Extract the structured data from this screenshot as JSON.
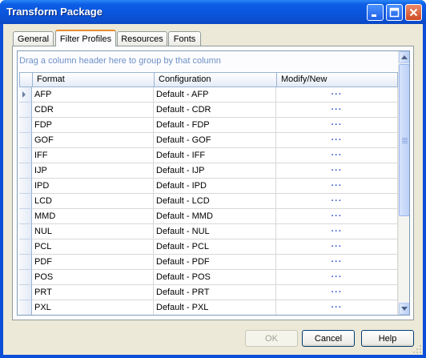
{
  "window": {
    "title": "Transform Package",
    "controls": {
      "minimize": "minimize-icon",
      "maximize": "maximize-icon",
      "close": "close-icon"
    }
  },
  "tabs": [
    {
      "label": "General",
      "active": false
    },
    {
      "label": "Filter Profiles",
      "active": true
    },
    {
      "label": "Resources",
      "active": false
    },
    {
      "label": "Fonts",
      "active": false
    }
  ],
  "grid": {
    "group_hint": "Drag a column header here to group by that column",
    "columns": [
      "Format",
      "Configuration",
      "Modify/New"
    ],
    "rows": [
      {
        "format": "AFP",
        "configuration": "Default - AFP",
        "action": "···"
      },
      {
        "format": "CDR",
        "configuration": "Default - CDR",
        "action": "···"
      },
      {
        "format": "FDP",
        "configuration": "Default - FDP",
        "action": "···"
      },
      {
        "format": "GOF",
        "configuration": "Default - GOF",
        "action": "···"
      },
      {
        "format": "IFF",
        "configuration": "Default - IFF",
        "action": "···"
      },
      {
        "format": "IJP",
        "configuration": "Default - IJP",
        "action": "···"
      },
      {
        "format": "IPD",
        "configuration": "Default - IPD",
        "action": "···"
      },
      {
        "format": "LCD",
        "configuration": "Default - LCD",
        "action": "···"
      },
      {
        "format": "MMD",
        "configuration": "Default - MMD",
        "action": "···"
      },
      {
        "format": "NUL",
        "configuration": "Default - NUL",
        "action": "···"
      },
      {
        "format": "PCL",
        "configuration": "Default - PCL",
        "action": "···"
      },
      {
        "format": "PDF",
        "configuration": "Default - PDF",
        "action": "···"
      },
      {
        "format": "POS",
        "configuration": "Default - POS",
        "action": "···"
      },
      {
        "format": "PRT",
        "configuration": "Default - PRT",
        "action": "···"
      },
      {
        "format": "PXL",
        "configuration": "Default - PXL",
        "action": "···"
      }
    ],
    "current_row_index": 0
  },
  "buttons": {
    "ok": "OK",
    "cancel": "Cancel",
    "help": "Help"
  }
}
